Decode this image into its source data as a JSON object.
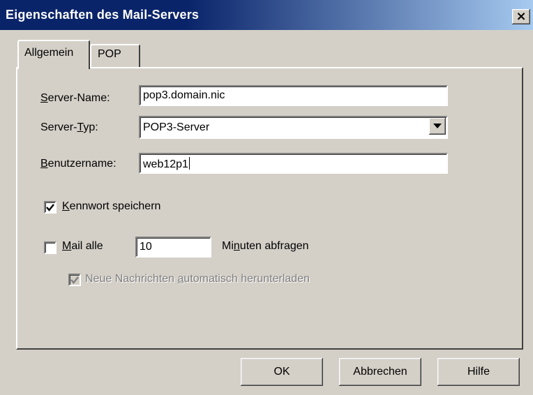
{
  "window": {
    "title": "Eigenschaften des Mail-Servers",
    "close_label": "×"
  },
  "tabs": [
    {
      "label": "Allgemein",
      "active": true
    },
    {
      "label": "POP",
      "active": false
    }
  ],
  "form": {
    "server_name": {
      "mnemonic": "S",
      "label_rest": "erver-Name:",
      "value": "pop3.domain.nic"
    },
    "server_type": {
      "label_pre": "Server-",
      "mnemonic": "T",
      "label_rest": "yp:",
      "value": "POP3-Server"
    },
    "username": {
      "mnemonic": "B",
      "label_rest": "enutzername:",
      "value": "web12p1"
    },
    "save_password": {
      "mnemonic": "K",
      "label_rest": "ennwort speichern",
      "checked": true
    },
    "check_mail": {
      "mnemonic": "M",
      "label_rest": "ail alle",
      "checked": false,
      "interval": "10"
    },
    "minutes": {
      "label_pre": "Mi",
      "mnemonic": "n",
      "label_rest": "uten abfragen"
    },
    "auto_download": {
      "label_pre": "Neue Nachrichten ",
      "mnemonic": "a",
      "label_rest": "utomatisch herunterladen",
      "checked": true,
      "disabled": true
    }
  },
  "buttons": {
    "ok": "OK",
    "cancel": "Abbrechen",
    "help": "Hilfe"
  }
}
